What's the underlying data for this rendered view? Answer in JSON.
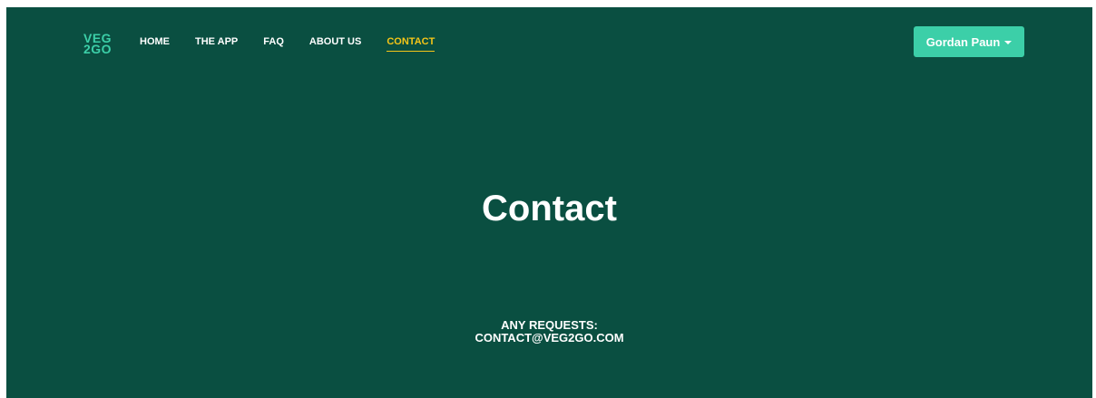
{
  "logo": {
    "line1": "VEG",
    "line2": "2GO"
  },
  "nav": {
    "items": [
      {
        "label": "HOME"
      },
      {
        "label": "THE APP"
      },
      {
        "label": "FAQ"
      },
      {
        "label": "ABOUT US"
      },
      {
        "label": "CONTACT",
        "active": true
      }
    ]
  },
  "user": {
    "name": "Gordan Paun"
  },
  "hero": {
    "title": "Contact"
  },
  "contact": {
    "line1": "ANY REQUESTS:",
    "line2": "CONTACT@VEG2GO.COM"
  },
  "colors": {
    "background": "#0a4f41",
    "accent": "#3ccfa8",
    "active_link": "#f5c518",
    "text": "#ffffff"
  }
}
